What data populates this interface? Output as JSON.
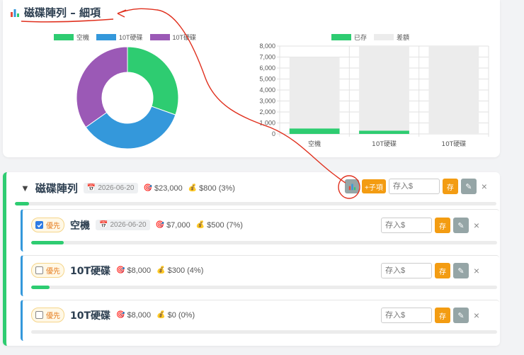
{
  "header": {
    "title": "磁碟陣列 – 細項"
  },
  "pie_legend": [
    {
      "label": "空機",
      "color": "#2ecc71"
    },
    {
      "label": "10T硬碟",
      "color": "#3498db"
    },
    {
      "label": "10T硬碟",
      "color": "#9b59b6"
    }
  ],
  "bar_legend": [
    {
      "label": "已存",
      "color": "#2ecc71"
    },
    {
      "label": "差額",
      "color": "#ececec"
    }
  ],
  "chart_data": [
    {
      "type": "pie",
      "variant": "doughnut",
      "labels": [
        "空機",
        "10T硬碟",
        "10T硬碟"
      ],
      "values": [
        7000,
        8000,
        8000
      ],
      "colors": [
        "#2ecc71",
        "#3498db",
        "#9b59b6"
      ]
    },
    {
      "type": "bar",
      "stacked": true,
      "categories": [
        "空機",
        "10T硬碟",
        "10T硬碟"
      ],
      "series": [
        {
          "name": "已存",
          "values": [
            500,
            300,
            0
          ],
          "color": "#2ecc71"
        },
        {
          "name": "差額",
          "values": [
            6500,
            7700,
            8000
          ],
          "color": "#ececec"
        }
      ],
      "ylim": [
        0,
        8000
      ],
      "yticks": [
        "0",
        "1,000",
        "2,000",
        "3,000",
        "4,000",
        "5,000",
        "6,000",
        "7,000",
        "8,000"
      ],
      "grid": true,
      "legend": "top"
    }
  ],
  "group": {
    "toggle": "▼",
    "name": "磁碟陣列",
    "date": "2026-06-20",
    "target": "$23,000",
    "saved": "$800 (3%)",
    "progress": 0.03,
    "add_label": "+子項",
    "deposit_placeholder": "存入$",
    "save_label": "存",
    "edit_label": "✎",
    "close_label": "×"
  },
  "items": [
    {
      "checked": true,
      "priority": "優先",
      "name": "空機",
      "date": "2026-06-20",
      "target": "$7,000",
      "saved": "$500 (7%)",
      "progress": 0.07,
      "deposit_placeholder": "存入$",
      "save_label": "存",
      "edit_label": "✎",
      "close_label": "×"
    },
    {
      "checked": false,
      "priority": "優先",
      "name": "10T硬碟",
      "target": "$8,000",
      "saved": "$300 (4%)",
      "progress": 0.04,
      "deposit_placeholder": "存入$",
      "save_label": "存",
      "edit_label": "✎",
      "close_label": "×"
    },
    {
      "checked": false,
      "priority": "優先",
      "name": "10T硬碟",
      "target": "$8,000",
      "saved": "$0 (0%)",
      "progress": 0,
      "deposit_placeholder": "存入$",
      "save_label": "存",
      "edit_label": "✎",
      "close_label": "×"
    }
  ]
}
